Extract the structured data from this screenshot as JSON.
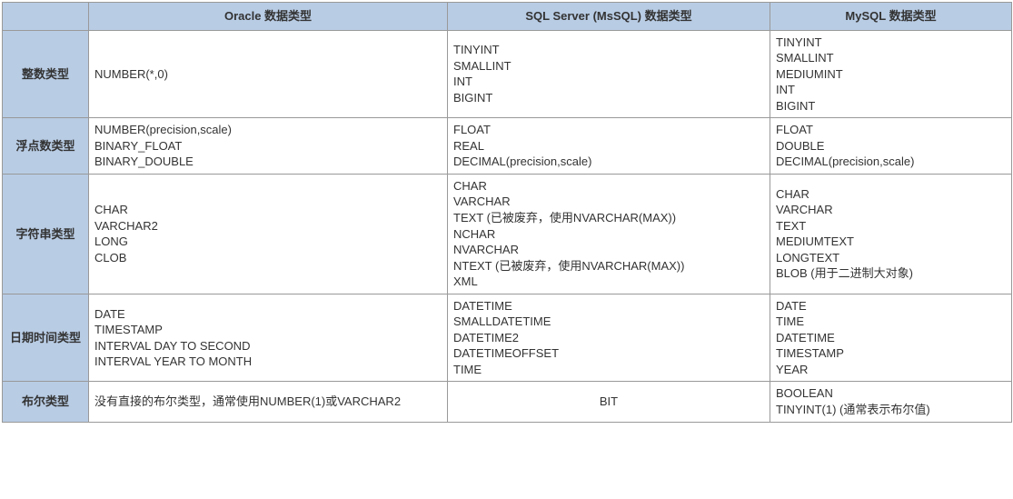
{
  "headers": {
    "corner": "",
    "oracle": "Oracle 数据类型",
    "mssql": "SQL Server (MsSQL) 数据类型",
    "mysql": "MySQL 数据类型"
  },
  "rows": [
    {
      "label": "整数类型",
      "oracle": "NUMBER(*,0)",
      "mssql": "TINYINT\nSMALLINT\nINT\nBIGINT",
      "mysql": "TINYINT\nSMALLINT\nMEDIUMINT\nINT\nBIGINT"
    },
    {
      "label": "浮点数类型",
      "oracle": "NUMBER(precision,scale)\nBINARY_FLOAT\nBINARY_DOUBLE",
      "mssql": "FLOAT\nREAL\nDECIMAL(precision,scale)",
      "mysql": "FLOAT\nDOUBLE\nDECIMAL(precision,scale)"
    },
    {
      "label": "字符串类型",
      "oracle": "CHAR\nVARCHAR2\nLONG\nCLOB",
      "mssql": "CHAR\nVARCHAR\nTEXT (已被废弃，使用NVARCHAR(MAX))\nNCHAR\nNVARCHAR\nNTEXT (已被废弃，使用NVARCHAR(MAX))\nXML",
      "mysql": "CHAR\nVARCHAR\nTEXT\nMEDIUMTEXT\nLONGTEXT\nBLOB (用于二进制大对象)"
    },
    {
      "label": "日期时间类型",
      "oracle": "DATE\nTIMESTAMP\nINTERVAL DAY TO SECOND\nINTERVAL YEAR TO MONTH",
      "mssql": "DATETIME\nSMALLDATETIME\nDATETIME2\nDATETIMEOFFSET\nTIME",
      "mysql": "DATE\nTIME\nDATETIME\nTIMESTAMP\nYEAR"
    },
    {
      "label": "布尔类型",
      "oracle": "没有直接的布尔类型，通常使用NUMBER(1)或VARCHAR2",
      "mssql": "BIT",
      "mysql": "BOOLEAN\nTINYINT(1) (通常表示布尔值)"
    }
  ]
}
